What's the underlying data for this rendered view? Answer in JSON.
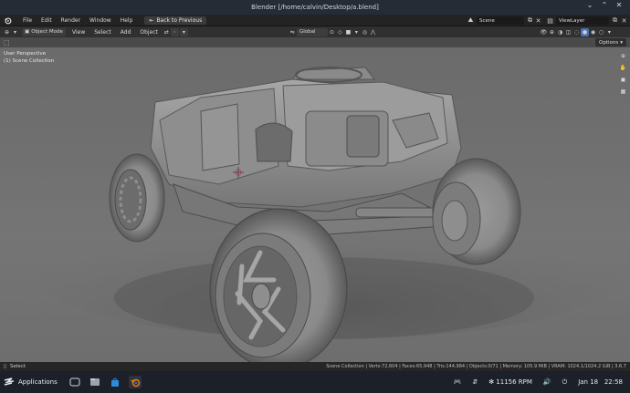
{
  "window": {
    "title": "Blender [/home/calvin/Desktop/a.blend]"
  },
  "topbar": {
    "menus": [
      "File",
      "Edit",
      "Render",
      "Window",
      "Help"
    ],
    "back_button": "Back to Previous",
    "scene_name": "Scene",
    "view_layer": "ViewLayer"
  },
  "header": {
    "mode": "Object Mode",
    "menus": [
      "View",
      "Select",
      "Add",
      "Object"
    ],
    "transform_orientation": "Global"
  },
  "options": {
    "label": "Options"
  },
  "viewport": {
    "perspective": "User Perspective",
    "collection": "(1) Scene Collection"
  },
  "statusbar": {
    "select_label": "Select",
    "stats": "Scene Collection | Verts:72,604 | Faces:65,948 | Tris:144,984 | Objects:0/71 | Memory: 105.9 MiB | VRAM: 1024.1/1024.2 GiB | 3.6.7"
  },
  "taskbar": {
    "applications_label": "Applications",
    "fan_rpm": "11156 RPM",
    "date": "Jan 18",
    "time": "22:58"
  },
  "colors": {
    "title_bg": "#262c36",
    "topbar_bg": "#232323",
    "header_bg": "#303030",
    "viewport_bg": "#6e6e6e",
    "taskbar_bg": "#1c2028",
    "accent_blue": "#4772b3",
    "blender_orange": "#e87d0d"
  }
}
